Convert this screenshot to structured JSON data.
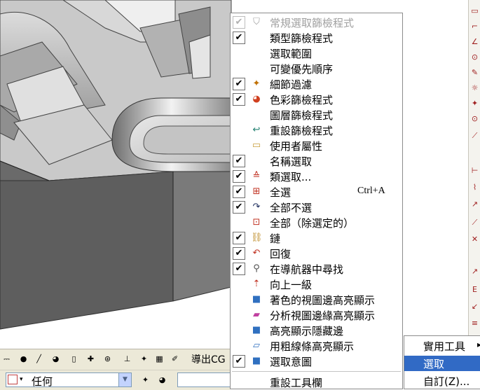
{
  "context_menu": {
    "items": [
      {
        "label": "常規選取篩檢程式",
        "checked": true,
        "disabled": true,
        "icon": "funnel-icon"
      },
      {
        "label": "類型篩檢程式",
        "checked": true,
        "disabled": false,
        "icon": ""
      },
      {
        "label": "選取範圍",
        "checked": false,
        "disabled": false,
        "icon": ""
      },
      {
        "label": "可變優先順序",
        "checked": false,
        "disabled": false,
        "icon": ""
      },
      {
        "label": "細節過濾",
        "checked": true,
        "disabled": false,
        "icon": "detail-filter-icon"
      },
      {
        "label": "色彩篩檢程式",
        "checked": true,
        "disabled": false,
        "icon": "palette-icon"
      },
      {
        "label": "圖層篩檢程式",
        "checked": false,
        "disabled": false,
        "icon": ""
      },
      {
        "label": "重設篩檢程式",
        "checked": false,
        "disabled": false,
        "icon": "reset-arrow-icon"
      },
      {
        "label": "使用者屬性",
        "checked": false,
        "disabled": false,
        "icon": "user-attribute-icon"
      },
      {
        "label": "名稱選取",
        "checked": true,
        "disabled": false,
        "icon": ""
      },
      {
        "label": "類選取...",
        "checked": true,
        "disabled": false,
        "icon": "class-select-icon"
      },
      {
        "label": "全選",
        "checked": true,
        "disabled": false,
        "icon": "select-all-icon",
        "shortcut": "Ctrl+A"
      },
      {
        "label": "全部不選",
        "checked": true,
        "disabled": false,
        "icon": "deselect-all-icon"
      },
      {
        "label": "全部（除選定的）",
        "checked": false,
        "disabled": false,
        "icon": "all-except-selected-icon"
      },
      {
        "label": "鏈",
        "checked": true,
        "disabled": false,
        "icon": "chain-icon"
      },
      {
        "label": "回復",
        "checked": true,
        "disabled": false,
        "icon": "undo-icon"
      },
      {
        "label": "在導航器中尋找",
        "checked": true,
        "disabled": false,
        "icon": "navigator-find-icon"
      },
      {
        "label": "向上一級",
        "checked": false,
        "disabled": false,
        "icon": "up-one-level-icon"
      },
      {
        "label": "著色的視圖邊高亮顯示",
        "checked": false,
        "disabled": false,
        "icon": "shaded-cube-icon"
      },
      {
        "label": "分析視圖邊緣高亮顯示",
        "checked": false,
        "disabled": false,
        "icon": "analysis-cube-icon"
      },
      {
        "label": "高亮顯示隱藏邊",
        "checked": false,
        "disabled": false,
        "icon": "hidden-edge-cube-icon"
      },
      {
        "label": "用粗線條高亮顯示",
        "checked": false,
        "disabled": false,
        "icon": "thick-line-cube-icon"
      },
      {
        "label": "選取意圖",
        "checked": true,
        "disabled": false,
        "icon": "selection-intent-cube-icon"
      }
    ],
    "reset_toolbar_label": "重設工具欄"
  },
  "submenu": {
    "items": [
      {
        "label": "實用工具",
        "selected": false
      },
      {
        "label": "選取",
        "selected": true
      },
      {
        "label": "自訂(Z)...",
        "selected": false
      }
    ]
  },
  "bottom_toolbar": {
    "export_label": "導出CG",
    "type_filter_value": "任何"
  },
  "colors": {
    "selection_highlight": "#316ac5",
    "menu_border": "#8c8c8c",
    "toolbar_bg": "#ece9d8"
  }
}
